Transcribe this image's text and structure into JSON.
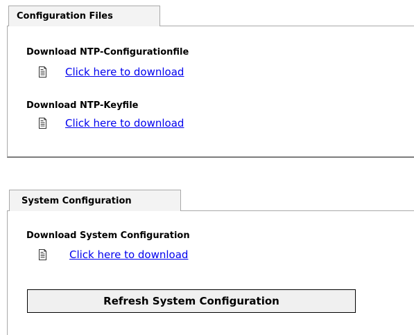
{
  "config_files": {
    "tab_label": "Configuration Files",
    "sections": [
      {
        "heading": "Download NTP-Configurationfile",
        "link_text": "Click here to download"
      },
      {
        "heading": "Download NTP-Keyfile",
        "link_text": "Click here to download"
      }
    ]
  },
  "system_config": {
    "tab_label": "System Configuration",
    "heading": "Download System Configuration",
    "link_text": "Click here to download",
    "refresh_button_label": "Refresh System Configuration"
  },
  "icons": {
    "download": "document-icon"
  },
  "colors": {
    "link": "#0000ee",
    "tab_background": "#f3f3f3",
    "border": "#a8a8a8",
    "button_background": "#f0f0f0"
  }
}
